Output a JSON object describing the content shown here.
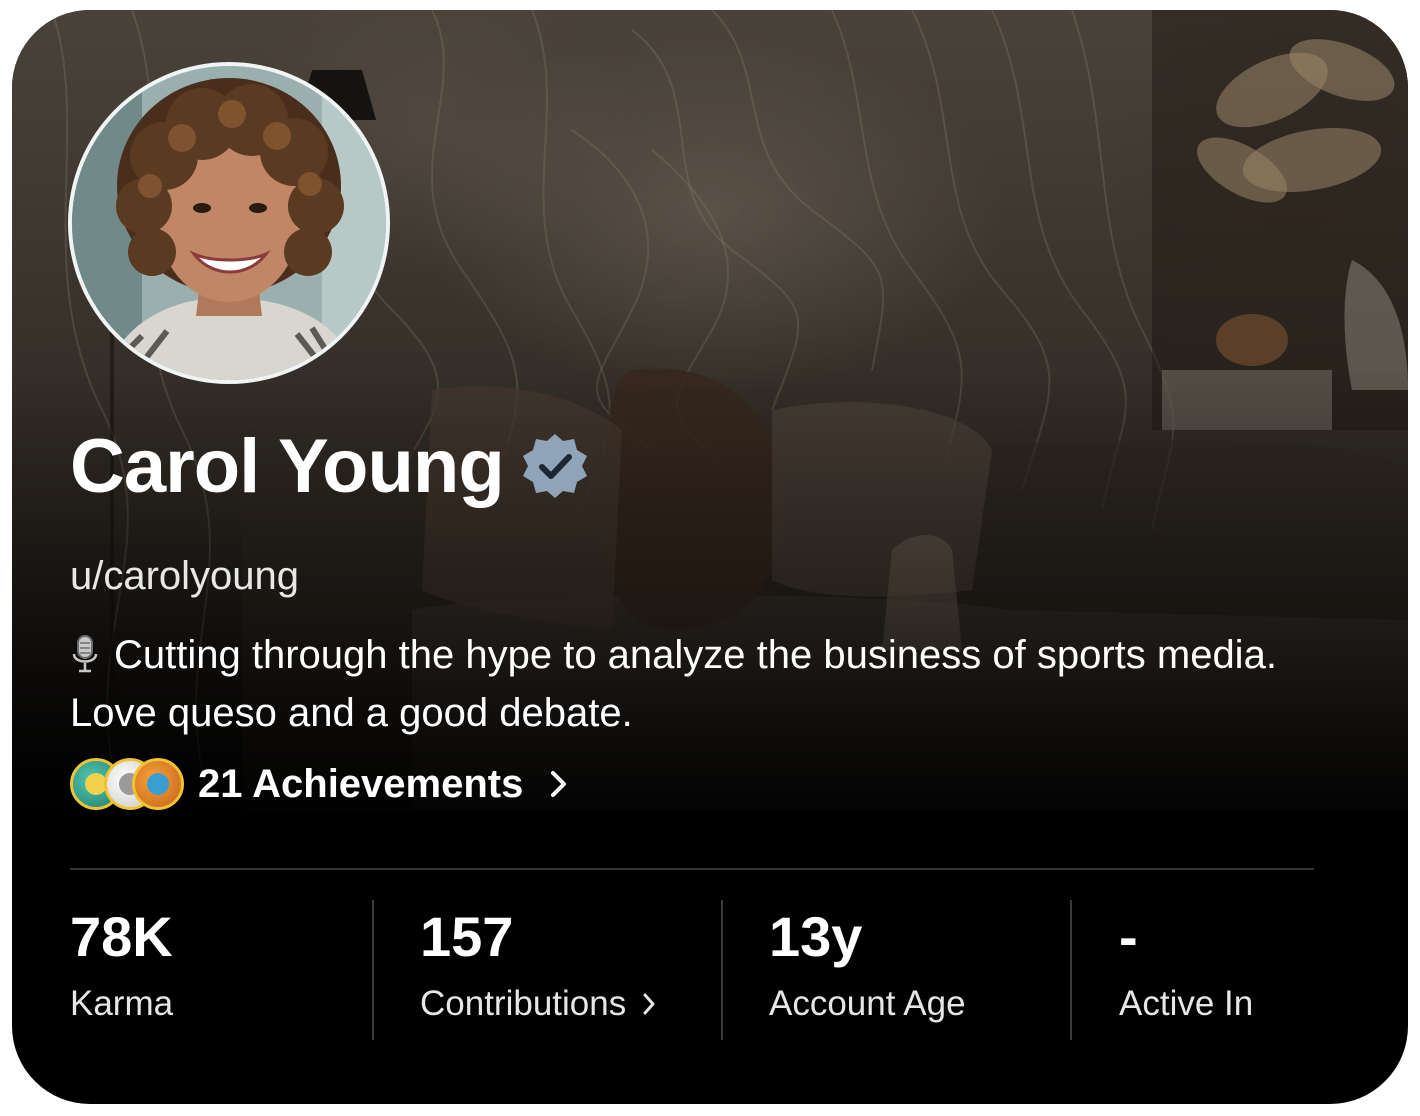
{
  "profile": {
    "display_name": "Carol Young",
    "verified": true,
    "username": "u/carolyoung",
    "bio": "Cutting through the hype to analyze the business of sports media. Love queso and a good debate.",
    "bio_icon": "microphone-icon"
  },
  "achievements": {
    "label": "21 Achievements",
    "badge_icons": [
      "achievement-badge-icon",
      "achievement-badge-icon",
      "achievement-badge-icon"
    ]
  },
  "stats": [
    {
      "value": "78K",
      "label": "Karma"
    },
    {
      "value": "157",
      "label": "Contributions"
    },
    {
      "value": "13y",
      "label": "Account Age"
    },
    {
      "value": "-",
      "label": "Active In"
    }
  ],
  "colors": {
    "card_background": "#000000",
    "verified_badge": "#8fa4b8",
    "text_primary": "#ffffff",
    "divider": "#333333"
  }
}
